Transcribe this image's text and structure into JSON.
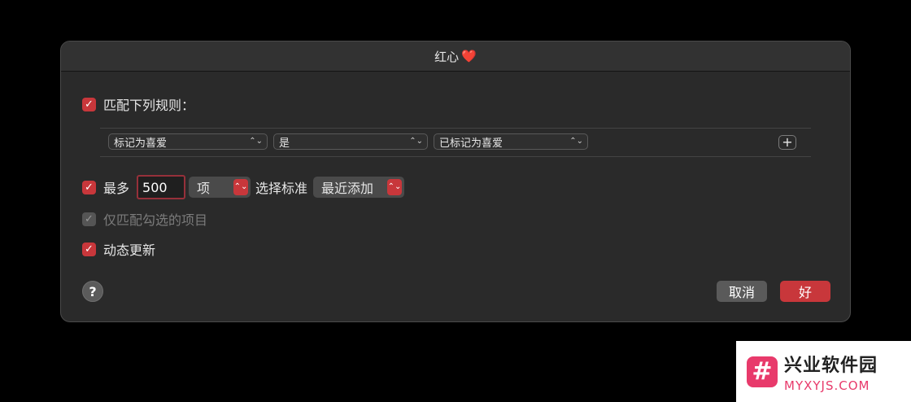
{
  "dialog": {
    "title": "红心",
    "title_emoji": "❤️"
  },
  "match_rules": {
    "checked": true,
    "label": "匹配下列规则："
  },
  "rule": {
    "field": "标记为喜爱",
    "operator": "是",
    "value": "已标记为喜爱",
    "add_button": "+"
  },
  "limit": {
    "checked": true,
    "label": "最多",
    "value": "500",
    "unit": "项",
    "selected_by_label": "选择标准",
    "selected_by": "最近添加"
  },
  "checked_only": {
    "checked": true,
    "disabled": true,
    "label": "仅匹配勾选的项目"
  },
  "live_update": {
    "checked": true,
    "label": "动态更新"
  },
  "buttons": {
    "help": "?",
    "cancel": "取消",
    "ok": "好"
  },
  "watermark": {
    "logo": "#",
    "title": "兴业软件园",
    "subtitle": "MYXYJS.COM"
  },
  "colors": {
    "accent": "#c8373b",
    "background": "#2a2a2a",
    "watermark_accent": "#e83a6b"
  }
}
